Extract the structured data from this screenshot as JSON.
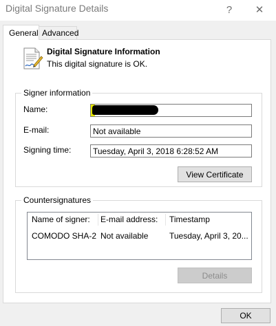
{
  "window": {
    "title": "Digital Signature Details",
    "help_glyph": "?",
    "close_glyph": "✕"
  },
  "tabs": [
    {
      "label": "General"
    },
    {
      "label": "Advanced"
    }
  ],
  "header": {
    "heading": "Digital Signature Information",
    "status": "This digital signature is OK."
  },
  "signer": {
    "group_label": "Signer information",
    "name_label": "Name:",
    "email_label": "E-mail:",
    "email_value": "Not available",
    "time_label": "Signing time:",
    "time_value": "Tuesday, April 3, 2018 6:28:52 AM",
    "view_cert_label": "View Certificate"
  },
  "counter": {
    "group_label": "Countersignatures",
    "columns": [
      "Name of signer:",
      "E-mail address:",
      "Timestamp"
    ],
    "rows": [
      [
        "COMODO SHA-2...",
        "Not available",
        "Tuesday, April 3, 20..."
      ]
    ],
    "details_label": "Details"
  },
  "footer": {
    "ok_label": "OK"
  }
}
